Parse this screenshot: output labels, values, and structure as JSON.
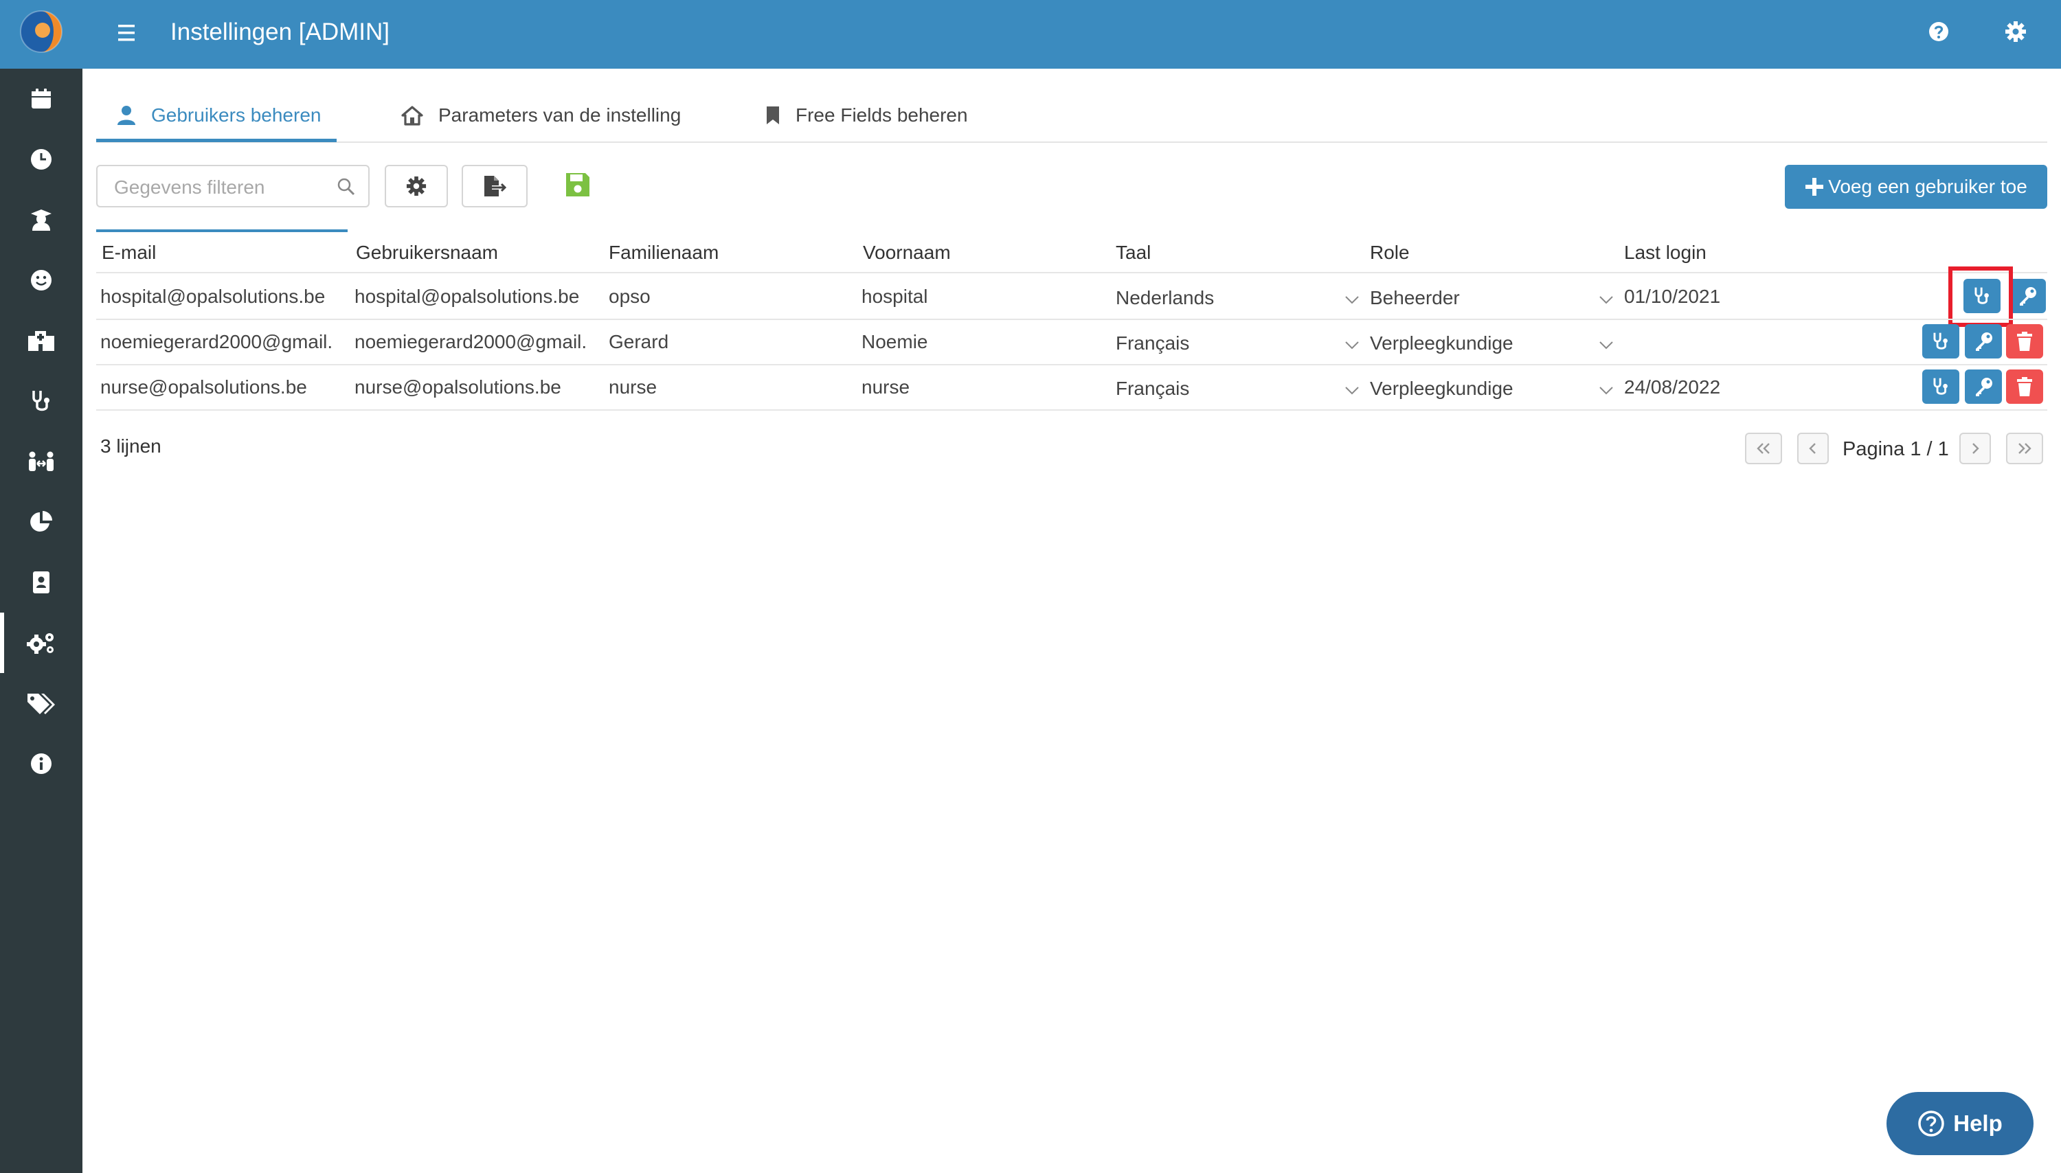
{
  "header": {
    "title": "Instellingen [ADMIN]",
    "menu_icon": "hamburger-icon",
    "help_icon": "question-circle-icon",
    "settings_icon": "gear-icon"
  },
  "sidebar": {
    "items": [
      {
        "icon": "calendar-icon"
      },
      {
        "icon": "clock-icon"
      },
      {
        "icon": "user-graduate-icon"
      },
      {
        "icon": "smiley-icon"
      },
      {
        "icon": "hospital-user-icon"
      },
      {
        "icon": "stethoscope-icon"
      },
      {
        "icon": "people-arrows-icon"
      },
      {
        "icon": "pie-chart-icon"
      },
      {
        "icon": "id-card-icon"
      },
      {
        "icon": "gears-icon",
        "active": true
      },
      {
        "icon": "tags-icon"
      },
      {
        "icon": "info-circle-icon"
      }
    ]
  },
  "tabs": [
    {
      "label": "Gebruikers beheren",
      "icon": "user-icon",
      "active": true
    },
    {
      "label": "Parameters van de instelling",
      "icon": "home-icon"
    },
    {
      "label": "Free Fields beheren",
      "icon": "bookmark-icon"
    }
  ],
  "toolbar": {
    "search_placeholder": "Gegevens filteren",
    "search_value": "",
    "add_user_label": "Voeg een gebruiker toe"
  },
  "table": {
    "columns": [
      "E-mail",
      "Gebruikersnaam",
      "Familienaam",
      "Voornaam",
      "Taal",
      "Role",
      "Last login"
    ],
    "rows": [
      {
        "email": "hospital@opalsolutions.be",
        "username": "hospital@opalsolutions.be",
        "lastname": "opso",
        "firstname": "hospital",
        "language": "Nederlands",
        "role": "Beheerder",
        "last_login": "01/10/2021"
      },
      {
        "email": "noemiegerard2000@gmail.",
        "username": "noemiegerard2000@gmail.",
        "lastname": "Gerard",
        "firstname": "Noemie",
        "language": "Français",
        "role": "Verpleegkundige",
        "last_login": ""
      },
      {
        "email": "nurse@opalsolutions.be",
        "username": "nurse@opalsolutions.be",
        "lastname": "nurse",
        "firstname": "nurse",
        "language": "Français",
        "role": "Verpleegkundige",
        "last_login": "24/08/2022"
      }
    ]
  },
  "footer": {
    "lines_count": "3 lijnen",
    "page_label": "Pagina 1 / 1"
  },
  "help": {
    "label": "Help"
  },
  "colors": {
    "primary": "#3b8bbf",
    "sidebar": "#2e3a3e",
    "danger": "#f05050",
    "save_green": "#7cc142",
    "highlight": "#e81e2c"
  }
}
